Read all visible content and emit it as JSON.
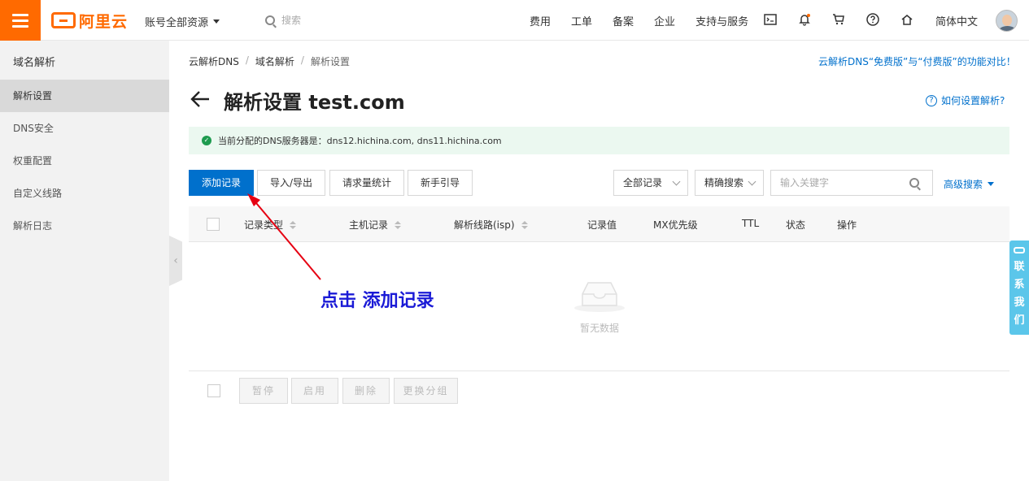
{
  "topbar": {
    "logo_text": "阿里云",
    "account": "账号全部资源",
    "search_placeholder": "搜索",
    "links": [
      "费用",
      "工单",
      "备案",
      "企业",
      "支持与服务"
    ],
    "icons": [
      "terminal-icon",
      "bell-icon",
      "cart-icon",
      "help-icon",
      "home-icon"
    ],
    "language": "简体中文"
  },
  "sidebar": {
    "title": "域名解析",
    "items": [
      {
        "label": "解析设置",
        "active": true
      },
      {
        "label": "DNS安全",
        "active": false
      },
      {
        "label": "权重配置",
        "active": false
      },
      {
        "label": "自定义线路",
        "active": false
      },
      {
        "label": "解析日志",
        "active": false
      }
    ],
    "collapse_glyph": "‹"
  },
  "breadcrumb": {
    "items": [
      "云解析DNS",
      "域名解析",
      "解析设置"
    ],
    "separator": "/"
  },
  "compare_link": "云解析DNS“免费版”与“付费版”的功能对比！",
  "page_title": "解析设置 test.com",
  "help_link": "如何设置解析?",
  "notice": "当前分配的DNS服务器是：dns12.hichina.com, dns11.hichina.com",
  "toolbar": {
    "add": "添加记录",
    "import_export": "导入/导出",
    "stats": "请求量统计",
    "guide": "新手引导",
    "filter_all": "全部记录",
    "filter_exact": "精确搜索",
    "search_placeholder": "输入关键字",
    "advanced": "高级搜索"
  },
  "table": {
    "columns": [
      "记录类型",
      "主机记录",
      "解析线路(isp)",
      "记录值",
      "MX优先级",
      "TTL",
      "状态",
      "操作"
    ],
    "empty_text": "暂无数据"
  },
  "footer_buttons": [
    "暂停",
    "启用",
    "删除",
    "更换分组"
  ],
  "annotation": "点击 添加记录",
  "contact": [
    "联",
    "系",
    "我",
    "们"
  ],
  "colors": {
    "brand": "#ff6a00",
    "primary": "#0070cc",
    "annotation": "#1a1ad6",
    "arrow": "#e60012",
    "contact": "#5bc6ea"
  }
}
